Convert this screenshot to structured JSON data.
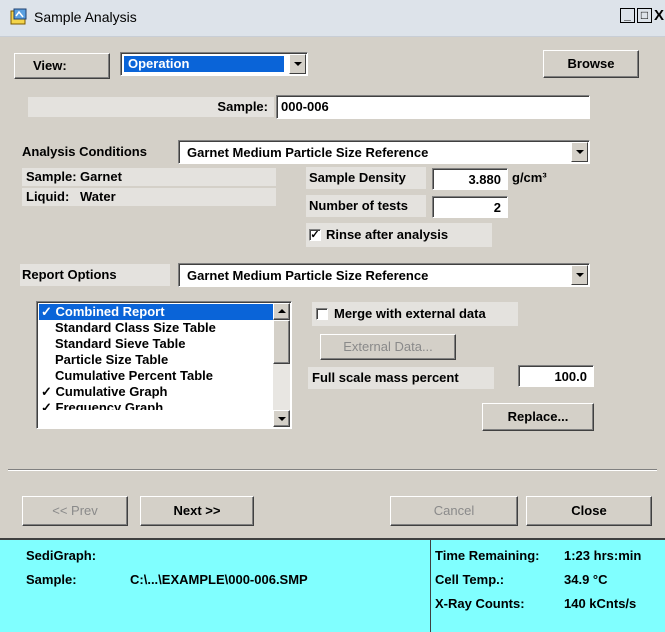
{
  "window": {
    "title": "Sample Analysis",
    "minimize": "_",
    "maximize": "□",
    "close": "X"
  },
  "toolbar": {
    "view_label": "View:",
    "view_value": "Operation",
    "browse_label": "Browse"
  },
  "sample": {
    "label": "Sample:",
    "value": "000-006"
  },
  "analysis": {
    "label": "Analysis Conditions",
    "value": "Garnet Medium Particle Size Reference",
    "sample_label": "Sample:",
    "sample_value": "Garnet",
    "liquid_label": "Liquid:",
    "liquid_value": "Water",
    "density_label": "Sample Density",
    "density_value": "3.880",
    "density_unit": "g/cm³",
    "tests_label": "Number of tests",
    "tests_value": "2",
    "rinse_label": "Rinse after analysis",
    "rinse_checked": true
  },
  "report": {
    "label": "Report Options",
    "value": "Garnet Medium Particle Size Reference",
    "items": [
      {
        "label": "✓ Combined Report",
        "selected": true
      },
      {
        "label": "Standard Class Size Table"
      },
      {
        "label": "Standard Sieve Table"
      },
      {
        "label": "Particle Size Table"
      },
      {
        "label": "Cumulative Percent Table"
      },
      {
        "label": "✓ Cumulative Graph"
      },
      {
        "label": "✓ Frequency Graph"
      }
    ],
    "merge_label": "Merge with external data",
    "merge_checked": false,
    "external_label": "External Data...",
    "fullscale_label": "Full scale mass percent",
    "fullscale_value": "100.0",
    "replace_label": "Replace..."
  },
  "nav": {
    "prev": "<< Prev",
    "next": "Next >>",
    "cancel": "Cancel",
    "close": "Close"
  },
  "status": {
    "device": "SediGraph:",
    "sample_label": "Sample:",
    "sample_value": "C:\\...\\EXAMPLE\\000-006.SMP",
    "time_label": "Time Remaining:",
    "time_value": "1:23 hrs:min",
    "temp_label": "Cell Temp.:",
    "temp_value": "34.9 °C",
    "xray_label": "X-Ray Counts:",
    "xray_value": "140 kCnts/s"
  },
  "colors": {
    "face": "#d4d0c8",
    "selection": "#0a64d8",
    "status_bg": "#80ffff",
    "titlebar": "#dde3ea"
  }
}
